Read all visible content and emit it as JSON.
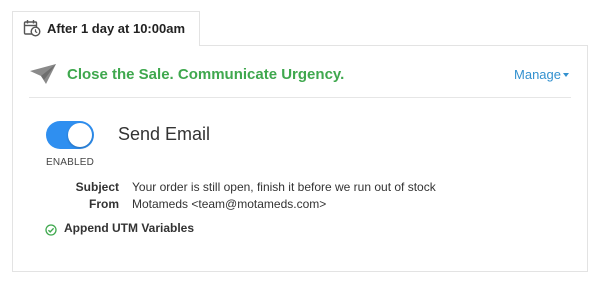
{
  "schedule": {
    "icon": "calendar-clock-icon",
    "label": "After 1 day at 10:00am"
  },
  "card": {
    "icon": "paper-plane-icon",
    "title": "Close the Sale. Communicate Urgency.",
    "manage_label": "Manage",
    "colors": {
      "title": "#3fa84e",
      "link": "#3391cf",
      "toggle_on": "#2f8ff0"
    }
  },
  "action": {
    "enabled": true,
    "status": "ENABLED",
    "title": "Send Email",
    "subject_label": "Subject",
    "subject_value": "Your order is still open, finish it before we run out of stock",
    "from_label": "From",
    "from_value": "Motameds <team@motameds.com>",
    "utm_icon": "check-circle-icon",
    "utm_label": "Append UTM Variables"
  }
}
